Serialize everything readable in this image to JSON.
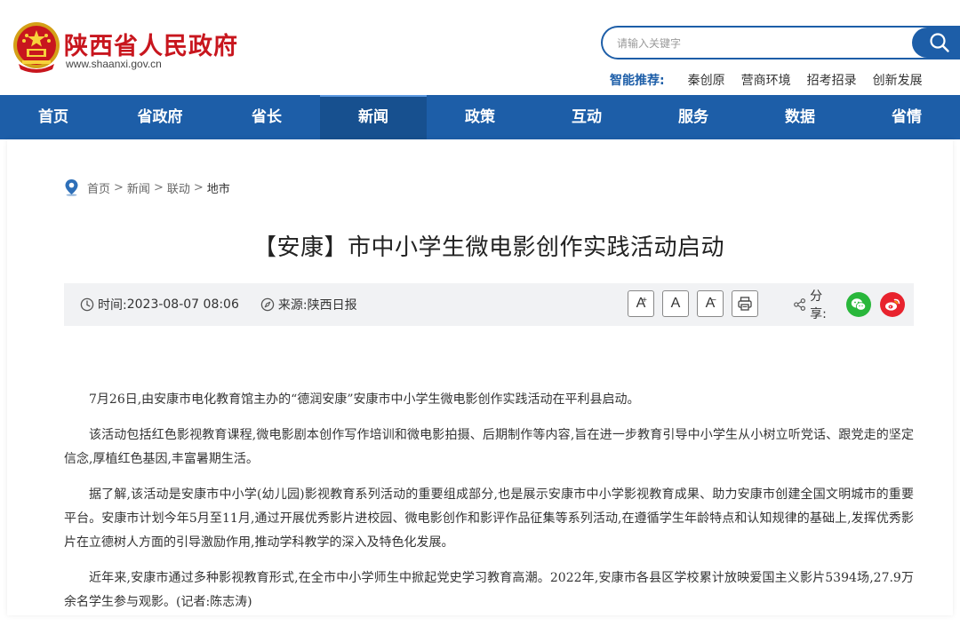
{
  "header": {
    "site_title": "陕西省人民政府",
    "site_domain": "www.shaanxi.gov.cn",
    "search_placeholder": "请输入关键字",
    "recommend_label": "智能推荐:",
    "recommend_items": [
      "秦创原",
      "营商环境",
      "招考招录",
      "创新发展"
    ]
  },
  "nav": {
    "items": [
      "首页",
      "省政府",
      "省长",
      "新闻",
      "政策",
      "互动",
      "服务",
      "数据",
      "省情"
    ],
    "active": "新闻"
  },
  "breadcrumb": {
    "items": [
      "首页",
      "新闻",
      "联动",
      "地市"
    ],
    "separator": ">"
  },
  "article": {
    "title": "【安康】市中小学生微电影创作实践活动启动",
    "meta": {
      "time_label": "时间:",
      "time_value": "2023-08-07 08:06",
      "source_label": "来源:",
      "source_value": "陕西日报",
      "font_buttons": [
        "A",
        "A",
        "A"
      ],
      "share_label": "分享:"
    },
    "paragraphs": [
      "7月26日,由安康市电化教育馆主办的“德润安康”安康市中小学生微电影创作实践活动在平利县启动。",
      "该活动包括红色影视教育课程,微电影剧本创作写作培训和微电影拍摄、后期制作等内容,旨在进一步教育引导中小学生从小树立听党话、跟党走的坚定信念,厚植红色基因,丰富暑期生活。",
      "据了解,该活动是安康市中小学(幼儿园)影视教育系列活动的重要组成部分,也是展示安康市中小学影视教育成果、助力安康市创建全国文明城市的重要平台。安康市计划今年5月至11月,通过开展优秀影片进校园、微电影创作和影评作品征集等系列活动,在遵循学生年龄特点和认知规律的基础上,发挥优秀影片在立德树人方面的引导激励作用,推动学科教学的深入及特色化发展。",
      "近年来,安康市通过多种影视教育形式,在全市中小学师生中掀起党史学习教育高潮。2022年,安康市各县区学校累计放映爱国主义影片5394场,27.9万余名学生参与观影。(记者:陈志涛)"
    ]
  },
  "colors": {
    "brand_red": "#c8161e",
    "nav_blue": "#1d5ea8",
    "meta_bg": "#f1f2f4",
    "wechat_green": "#29b73b",
    "weibo_red": "#e8232e"
  },
  "icons": [
    "national-emblem-icon",
    "search-icon",
    "location-icon",
    "clock-icon",
    "compass-icon",
    "print-icon",
    "share-icon",
    "wechat-icon",
    "weibo-icon"
  ]
}
